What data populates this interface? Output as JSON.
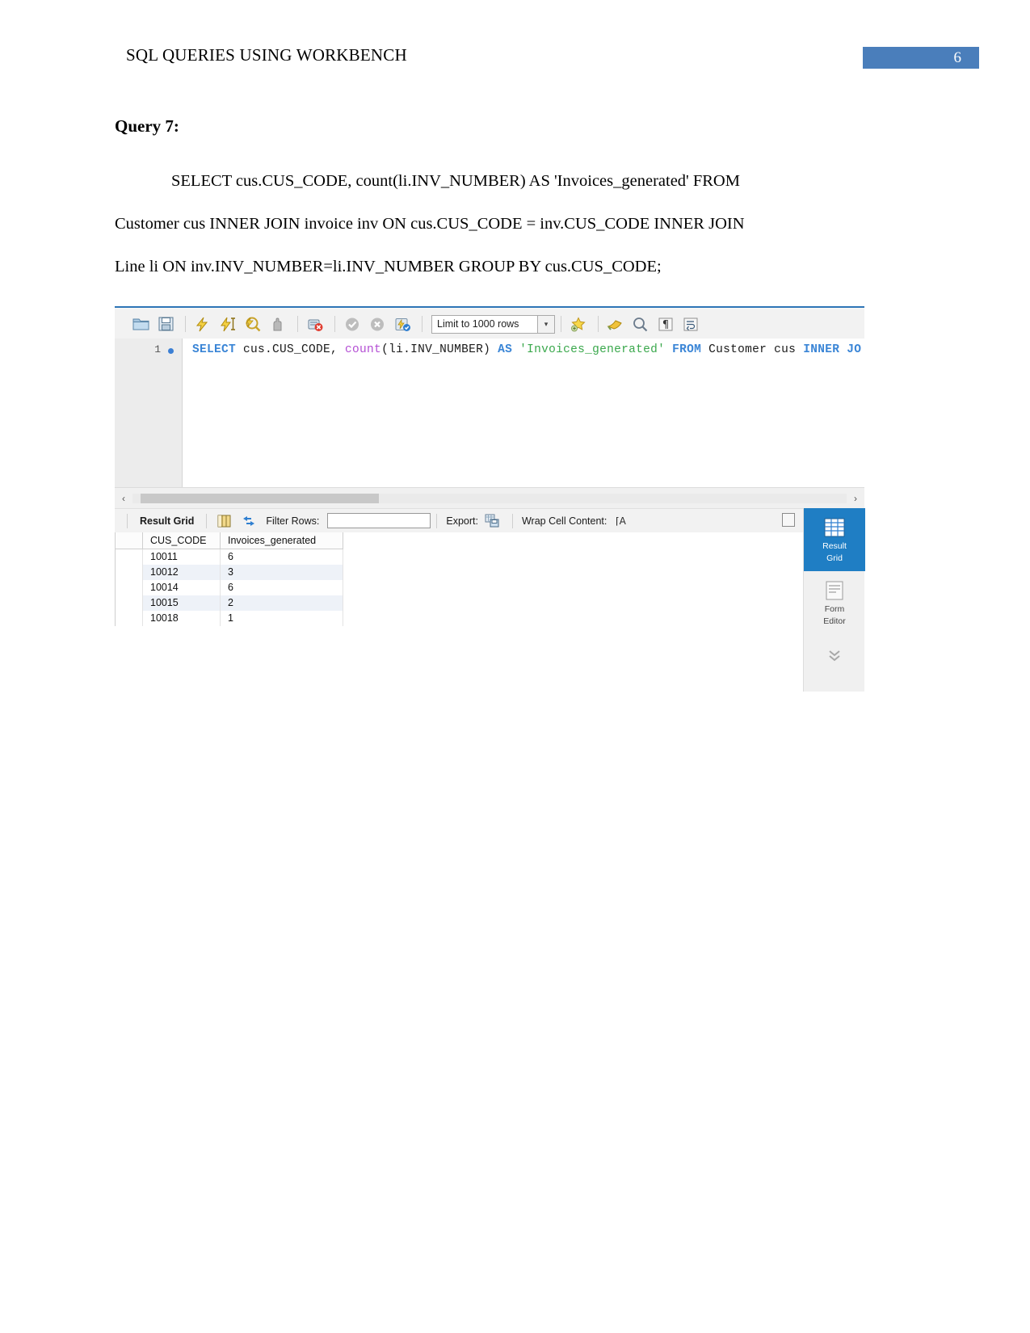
{
  "header": {
    "title": "SQL QUERIES USING WORKBENCH",
    "page_number": "6",
    "badge_color": "#4a7ebb"
  },
  "document": {
    "query_heading": "Query 7:",
    "sql_lines": [
      "SELECT  cus.CUS_CODE,  count(li.INV_NUMBER)  AS  'Invoices_generated'  FROM",
      "Customer cus INNER JOIN invoice inv ON cus.CUS_CODE = inv.CUS_CODE INNER JOIN",
      "Line li ON inv.INV_NUMBER=li.INV_NUMBER GROUP BY cus.CUS_CODE;"
    ]
  },
  "workbench": {
    "toolbar": {
      "limit_value": "Limit to 1000 rows",
      "limit_dropdown_glyph": "▾",
      "icons": [
        "open-folder-icon",
        "save-icon",
        "execute-icon",
        "execute-current-statement-icon",
        "explain-query-icon",
        "stop-on-error-icon",
        "toggle-stop-icon",
        "commit-icon",
        "rollback-icon",
        "autocommit-icon",
        "beautify-sql-icon",
        "find-icon",
        "search-icon",
        "toggle-invisible-chars-icon",
        "wrap-lines-icon"
      ]
    },
    "editor": {
      "line_number": "1",
      "code_tokens": [
        {
          "t": "SELECT",
          "k": "kw"
        },
        {
          "t": " cus.CUS_CODE, ",
          "k": "pl"
        },
        {
          "t": "count",
          "k": "fn"
        },
        {
          "t": "(li.INV_NUMBER) ",
          "k": "pl"
        },
        {
          "t": "AS",
          "k": "kw"
        },
        {
          "t": " 'Invoices_generated' ",
          "k": "str"
        },
        {
          "t": "FROM",
          "k": "kw"
        },
        {
          "t": " Customer cus ",
          "k": "pl"
        },
        {
          "t": "INNER",
          "k": "kw"
        },
        {
          "t": " ",
          "k": "pl"
        },
        {
          "t": "JO",
          "k": "kw"
        }
      ]
    },
    "hscroll": {
      "left_arrow": "‹",
      "right_arrow": "›"
    },
    "results_toolbar": {
      "result_grid_label": "Result Grid",
      "grid_view_icon": "grid-view-icon",
      "refresh_icon": "refresh-icon",
      "filter_rows_label": "Filter Rows:",
      "filter_rows_value": "",
      "filter_rows_placeholder": "",
      "export_label": "Export:",
      "export_icon": "export-icon",
      "wrap_cell_label": "Wrap Cell Content:",
      "wrap_cell_icon": "wrap-text-icon",
      "maximize_icon": "maximize-panel-icon"
    },
    "result_grid": {
      "columns": [
        "CUS_CODE",
        "Invoices_generated"
      ],
      "rows": [
        [
          "10011",
          "6"
        ],
        [
          "10012",
          "3"
        ],
        [
          "10014",
          "6"
        ],
        [
          "10015",
          "2"
        ],
        [
          "10018",
          "1"
        ]
      ]
    },
    "side_panel": {
      "items": [
        {
          "label1": "Result",
          "label2": "Grid",
          "icon": "result-grid-icon",
          "active": true
        },
        {
          "label1": "Form",
          "label2": "Editor",
          "icon": "form-editor-icon",
          "active": false
        }
      ],
      "expand_glyph": "⌄",
      "active_color": "#1f7ec4"
    }
  }
}
